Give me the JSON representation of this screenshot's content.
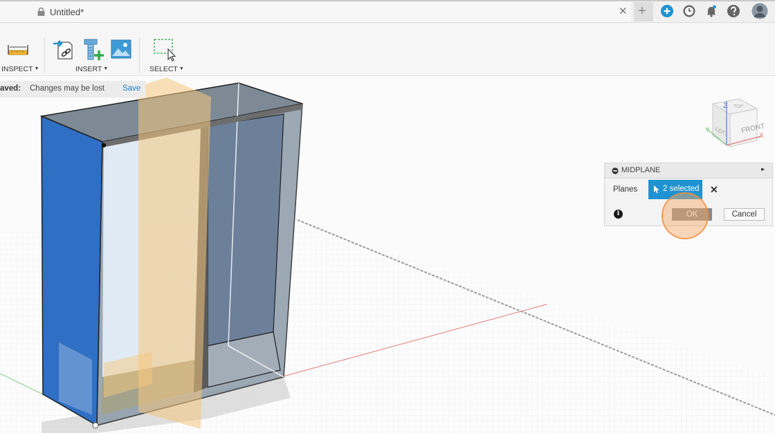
{
  "app": {
    "tab_title": "Untitled*",
    "close_glyph": "✕",
    "new_tab_glyph": "+",
    "icons": [
      "add-circle-icon",
      "clock-icon",
      "bell-icon",
      "help-icon",
      "user-avatar-icon"
    ]
  },
  "toolbar": {
    "inspect_label": "INSPECT",
    "insert_label": "INSERT",
    "select_label": "SELECT",
    "caret": "▼"
  },
  "unsaved_bar": {
    "prefix": "aved:",
    "message": "Changes may be lost",
    "save_link": "Save"
  },
  "viewcube": {
    "top_face": "TOP",
    "front_face": "FRONT",
    "left_face": "LEFT",
    "axes": [
      "Z",
      "X",
      "Y"
    ]
  },
  "midplane_panel": {
    "title": "MIDPLANE",
    "planes_label": "Planes",
    "selection_text": "2 selected",
    "clear_glyph": "✕",
    "info_glyph": "i",
    "ok_label": "OK",
    "cancel_label": "Cancel",
    "expand_glyph": "▸▸"
  },
  "colors": {
    "accent_blue": "#1f93d1",
    "selected_face_blue": "#2f6fc4",
    "midplane_orange": "#f6c77e",
    "click_highlight": "#f6a560"
  }
}
